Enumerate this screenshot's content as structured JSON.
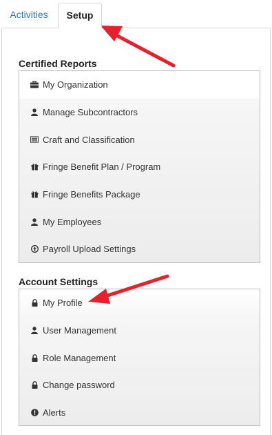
{
  "tabs": [
    {
      "label": "Activities",
      "active": false
    },
    {
      "label": "Setup",
      "active": true
    }
  ],
  "certified_reports": {
    "title": "Certified Reports",
    "items": [
      {
        "label": "My Organization",
        "icon": "briefcase-icon"
      },
      {
        "label": "Manage Subcontractors",
        "icon": "user-icon"
      },
      {
        "label": "Craft and Classification",
        "icon": "list-icon"
      },
      {
        "label": "Fringe Benefit Plan / Program",
        "icon": "gift-icon"
      },
      {
        "label": "Fringe Benefits Package",
        "icon": "gift-icon"
      },
      {
        "label": "My Employees",
        "icon": "user-icon"
      },
      {
        "label": "Payroll Upload Settings",
        "icon": "upload-icon"
      }
    ]
  },
  "account_settings": {
    "title": "Account Settings",
    "items": [
      {
        "label": "My Profile",
        "icon": "lock-icon"
      },
      {
        "label": "User Management",
        "icon": "user-icon"
      },
      {
        "label": "Role Management",
        "icon": "lock-icon"
      },
      {
        "label": "Change password",
        "icon": "lock-icon"
      },
      {
        "label": "Alerts",
        "icon": "alert-icon"
      }
    ]
  },
  "colors": {
    "accent_link": "#2a7ab8",
    "annotation_arrow": "#e8202a"
  }
}
